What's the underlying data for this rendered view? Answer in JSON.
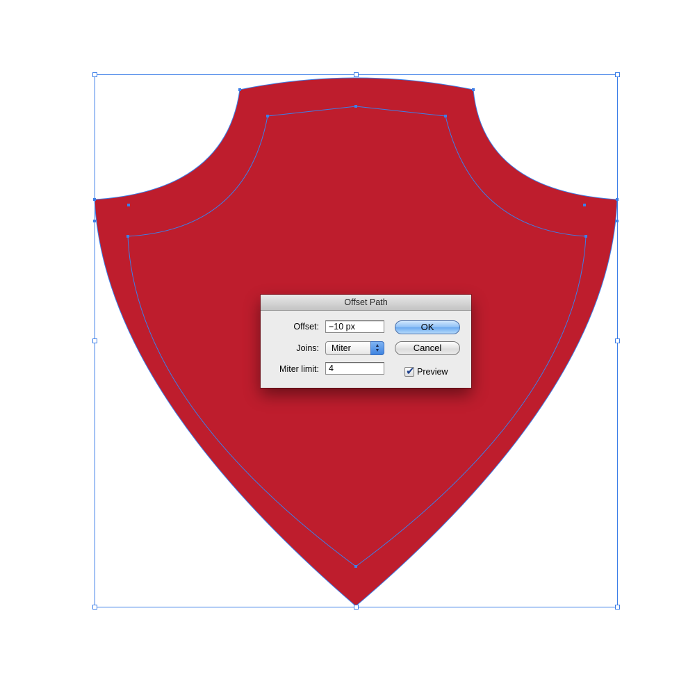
{
  "canvas": {
    "shield_fill": "#be1d2d",
    "selection_color": "#3d7fe8"
  },
  "dialog": {
    "title": "Offset Path",
    "offset_label": "Offset:",
    "offset_value": "−10 px",
    "joins_label": "Joins:",
    "joins_value": "Miter",
    "miter_label": "Miter limit:",
    "miter_value": "4",
    "ok_label": "OK",
    "cancel_label": "Cancel",
    "preview_label": "Preview",
    "preview_checked": true
  }
}
